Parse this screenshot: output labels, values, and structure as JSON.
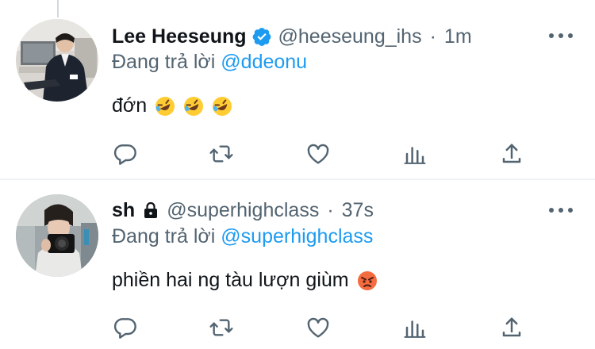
{
  "tweets": [
    {
      "display_name": "Lee Heeseung",
      "verified": true,
      "handle": "@heeseung_ihs",
      "separator": "·",
      "time": "1m",
      "reply_prefix": "Đang trả lời",
      "reply_to": "@ddeonu",
      "text": "đớn",
      "emojis": [
        "rolling-on-floor-laughing",
        "rolling-on-floor-laughing",
        "rolling-on-floor-laughing"
      ]
    },
    {
      "display_name": "sh",
      "protected": true,
      "handle": "@superhighclass",
      "separator": "·",
      "time": "37s",
      "reply_prefix": "Đang trả lời",
      "reply_to": "@superhighclass",
      "text": "phiền hai ng tàu lượn giùm",
      "emojis": [
        "angry-face"
      ]
    }
  ],
  "colors": {
    "text": "#0f1419",
    "secondary": "#536471",
    "link": "#1d9bf0",
    "verified": "#1d9bf0",
    "divider": "#eff3f4"
  },
  "actions": [
    "reply-icon",
    "retweet-icon",
    "like-icon",
    "analytics-icon",
    "share-icon"
  ]
}
